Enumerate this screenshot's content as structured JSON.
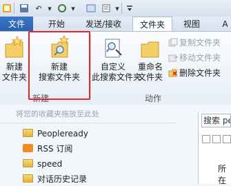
{
  "tabs": {
    "file": "文件",
    "home": "开始",
    "send_receive": "发送/接收",
    "folder": "文件夹",
    "view": "视图",
    "overflow": "A"
  },
  "ribbon": {
    "new_group": {
      "label": "新建",
      "new_folder_line1": "新建",
      "new_folder_line2": "文件夹",
      "new_search_line1": "新建",
      "new_search_line2": "搜索文件夹"
    },
    "actions_group": {
      "label": "动作",
      "custom_line1": "自定义",
      "custom_line2": "此搜索文件夹",
      "rename_line1": "重命名",
      "rename_line2": "文件夹",
      "copy_folder": "复制文件夹",
      "move_folder": "移动文件夹",
      "delete_folder": "删除文件夹"
    }
  },
  "navigation": {
    "favorites_hint": "将您的收藏夹拖放至此处",
    "items": [
      "Peopleready",
      "RSS 订阅",
      "speed",
      "对话历史记录"
    ]
  },
  "search": {
    "value": "搜索 pe"
  },
  "right_pane": {
    "label": "所在"
  },
  "colors": {
    "file_tab": "#2f6ab8",
    "highlight": "#e2262b"
  }
}
